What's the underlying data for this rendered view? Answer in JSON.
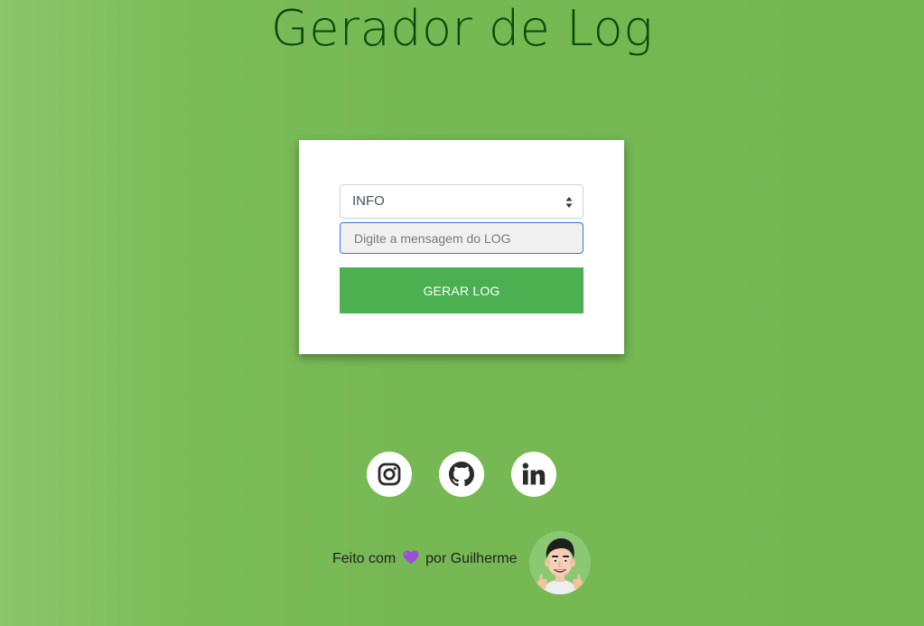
{
  "page": {
    "title": "Gerador de Log"
  },
  "form": {
    "level_select": {
      "selected": "INFO"
    },
    "message_input": {
      "placeholder": "Digite a mensagem do LOG",
      "value": ""
    },
    "submit_label": "GERAR LOG"
  },
  "social": {
    "items": [
      {
        "icon": "instagram-icon"
      },
      {
        "icon": "github-icon"
      },
      {
        "icon": "linkedin-icon"
      }
    ]
  },
  "footer": {
    "text_before": "Feito com",
    "heart_icon": "purple-heart-icon",
    "text_after": "por Guilherme",
    "avatar_icon": "memoji-avatar"
  },
  "colors": {
    "background": "#76b853",
    "title": "#0c4a0c",
    "button": "#4caf50",
    "input_focus_border": "#2c7be5",
    "heart": "#9b4fd6"
  }
}
